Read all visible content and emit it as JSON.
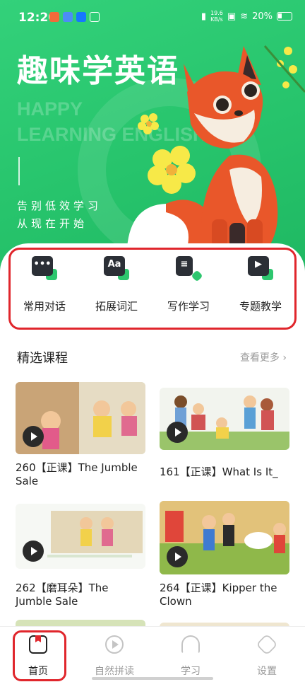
{
  "status_bar": {
    "time": "12:20",
    "net_speed_value": "19.6",
    "net_speed_unit": "KB/s",
    "battery": "20%"
  },
  "hero": {
    "title": "趣味学英语",
    "subtitle_line1": "HAPPY",
    "subtitle_line2": "LEARNING ENGLISH",
    "slogan_line1": "告别低效学习",
    "slogan_line2": "从现在开始",
    "mascot": "fox-illustration",
    "accent_color": "#2dc66e"
  },
  "menu": {
    "items": [
      {
        "label": "常用对话",
        "icon": "chat-bubble-icon"
      },
      {
        "label": "拓展词汇",
        "icon": "vocabulary-icon",
        "mark": "Aa"
      },
      {
        "label": "写作学习",
        "icon": "writing-icon"
      },
      {
        "label": "专题教学",
        "icon": "video-lesson-icon"
      }
    ]
  },
  "section": {
    "title": "精选课程",
    "more": "查看更多"
  },
  "courses": [
    {
      "title": "260【正课】The Jumble Sale"
    },
    {
      "title": "161【正课】What Is It_"
    },
    {
      "title": "262【磨耳朵】The Jumble Sale"
    },
    {
      "title": "264【正课】Kipper the Clown"
    }
  ],
  "tabs": [
    {
      "label": "首页",
      "icon": "home-bookmark-icon",
      "active": true
    },
    {
      "label": "自然拼读",
      "icon": "play-circle-icon",
      "active": false
    },
    {
      "label": "学习",
      "icon": "headphones-icon",
      "active": false
    },
    {
      "label": "设置",
      "icon": "settings-hexagon-icon",
      "active": false
    }
  ]
}
